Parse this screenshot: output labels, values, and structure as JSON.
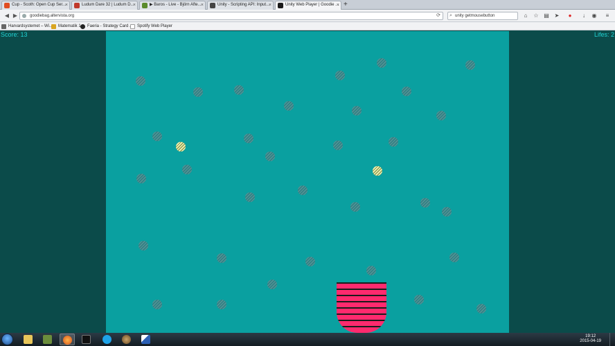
{
  "browser": {
    "tabs": [
      {
        "title": "Cup - Scoth: Open Cup Ser...",
        "color": "#e04d22",
        "active": false
      },
      {
        "title": "Ludum Dare 32 | Ludum D...",
        "color": "#c0392b",
        "active": false
      },
      {
        "title": "▶ Baros - Live - Björn Afte...",
        "color": "#5b8b2c",
        "active": false
      },
      {
        "title": "Unity - Scripting API: Input...",
        "color": "#444444",
        "active": false
      },
      {
        "title": "Unity Web Player | Goodie ...",
        "color": "#1b1b1b",
        "active": true
      }
    ],
    "new_tab": "+",
    "url": "goodiebag.altervista.org",
    "search_value": "unity getmousebutton",
    "bookmarks": [
      {
        "label": "Harvardsystemet – Wi...",
        "color": "#666666"
      },
      {
        "label": "Matematik 1",
        "color": "#d9a520"
      },
      {
        "label": "Faeria - Strategy Card ...",
        "color": "#222222"
      },
      {
        "label": "Spotify Web Player",
        "color": "#ffffff"
      }
    ],
    "toolbar_icons": [
      "home-icon",
      "star-icon",
      "library-icon",
      "send-icon",
      "addon-icon",
      "download-icon",
      "chat-icon",
      "menu-icon"
    ]
  },
  "game": {
    "score_text": "Score: 13",
    "lifes_text": "Lifes: 2",
    "playfield_color": "#0aa0a0",
    "side_color": "#0b4b4a",
    "cup_color": "#ff2a6e",
    "hud_color": "#20d4d4"
  },
  "taskbar": {
    "apps": [
      "explorer-icon",
      "minecraft-icon",
      "firefox-icon",
      "terminal-icon",
      "skype-icon",
      "globe-icon",
      "paint-icon"
    ],
    "time": "19:12",
    "date": "2015-04-19"
  }
}
